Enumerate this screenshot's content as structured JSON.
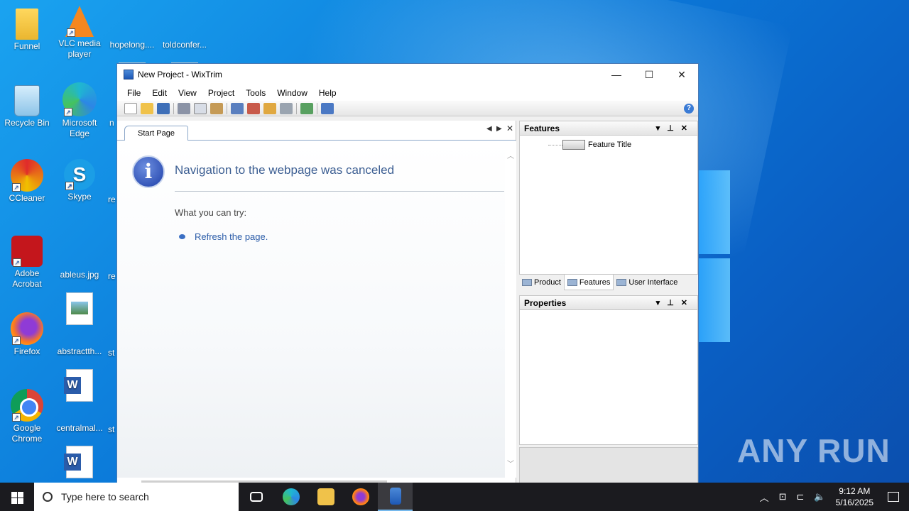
{
  "desktop": {
    "icons": [
      {
        "label": "Funnel"
      },
      {
        "label": "VLC media player"
      },
      {
        "label": "hopelong...."
      },
      {
        "label": "toldconfer..."
      },
      {
        "label": "Recycle Bin"
      },
      {
        "label": "Microsoft Edge"
      },
      {
        "label": "CCleaner"
      },
      {
        "label": "Skype"
      },
      {
        "label": "Adobe Acrobat"
      },
      {
        "label": "ableus.jpg"
      },
      {
        "label": "Firefox"
      },
      {
        "label": "abstractth..."
      },
      {
        "label": "Google Chrome"
      },
      {
        "label": "centralmal..."
      }
    ],
    "cut_labels": [
      "n",
      "re",
      "re",
      "st",
      "st"
    ]
  },
  "window": {
    "title": "New Project - WixTrim",
    "menu": [
      "File",
      "Edit",
      "View",
      "Project",
      "Tools",
      "Window",
      "Help"
    ],
    "help_glyph": "?",
    "document": {
      "tab_label": "Start Page",
      "heading": "Navigation to the webpage was canceled",
      "try_label": "What you can try:",
      "refresh_link": "Refresh the page."
    },
    "features_panel": {
      "title": "Features",
      "tree_item": "Feature Title",
      "tabs": [
        "Product",
        "Features",
        "User Interface"
      ],
      "selected_tab": "Features"
    },
    "properties_panel": {
      "title": "Properties"
    }
  },
  "watermark": "ANY RUN",
  "taskbar": {
    "search_placeholder": "Type here to search",
    "time": "9:12 AM",
    "date": "5/16/2025"
  },
  "colors": {
    "desktop": "#0b78d8",
    "accent_link": "#2a5ba8",
    "heading": "#3c5e92"
  }
}
